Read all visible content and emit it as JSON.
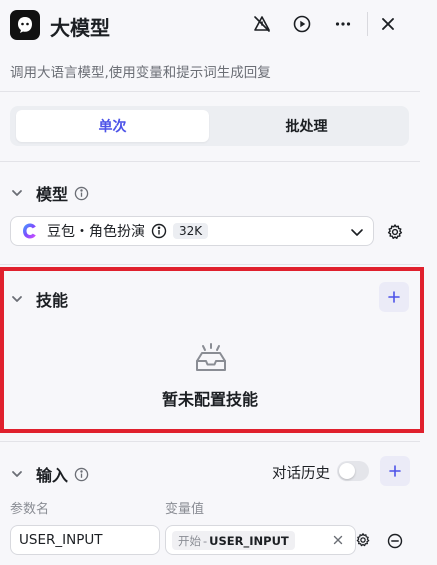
{
  "header": {
    "title": "大模型",
    "description": "调用大语言模型,使用变量和提示词生成回复"
  },
  "tabs": [
    {
      "label": "单次",
      "active": true
    },
    {
      "label": "批处理",
      "active": false
    }
  ],
  "model_section": {
    "title": "模型",
    "selected_model": "豆包・角色扮演",
    "context_badge": "32K"
  },
  "skills_section": {
    "title": "技能",
    "empty_text": "暂未配置技能"
  },
  "input_section": {
    "title": "输入",
    "history_label": "对话历史",
    "history_enabled": false,
    "param_col_label": "参数名",
    "value_col_label": "变量值",
    "rows": [
      {
        "param": "USER_INPUT",
        "source": "开始",
        "separator": "-",
        "variable": "USER_INPUT"
      }
    ]
  },
  "colors": {
    "accent": "#4d53e8",
    "highlight_border": "#e0202d",
    "background": "#f7f7fa"
  }
}
